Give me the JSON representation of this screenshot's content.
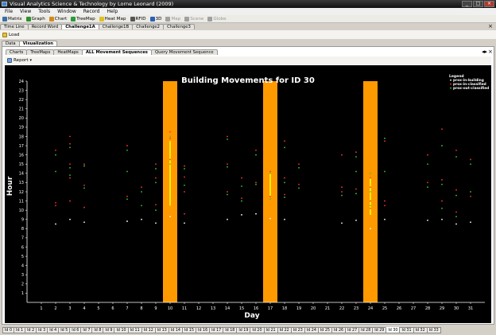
{
  "window": {
    "title": "Visual Analytics Science & Technology by Lorne Leonard (2009)"
  },
  "menu": [
    "File",
    "View",
    "Tools",
    "Window",
    "Record",
    "Help"
  ],
  "toolbar": [
    {
      "label": "Matrix",
      "icon": "matrix-icon",
      "color": "#3a6ea5",
      "enabled": true
    },
    {
      "label": "Graph",
      "icon": "graph-icon",
      "color": "#2f8f2f",
      "enabled": true
    },
    {
      "label": "Chart",
      "icon": "chart-icon",
      "color": "#d08a1a",
      "enabled": true
    },
    {
      "label": "TreeMap",
      "icon": "treemap-icon",
      "color": "#2a9a3a",
      "enabled": true
    },
    {
      "label": "Heat Map",
      "icon": "heatmap-icon",
      "color": "#e0c020",
      "enabled": true
    },
    {
      "label": "RFID",
      "icon": "rfid-icon",
      "color": "#555555",
      "enabled": true
    },
    {
      "label": "3D",
      "icon": "3d-icon",
      "color": "#2b5fb5",
      "enabled": true
    },
    {
      "label": "Map",
      "icon": "map-icon",
      "color": "#a0a0a0",
      "enabled": false
    },
    {
      "label": "Scene",
      "icon": "scene-icon",
      "color": "#a0a0a0",
      "enabled": false
    },
    {
      "label": "Globe",
      "icon": "globe-icon",
      "color": "#a0a0a0",
      "enabled": false
    }
  ],
  "doc_tabs": [
    "Time Line",
    "Record Word",
    "Challenge1A",
    "Challenge1B",
    "Challenge2",
    "Challenge3"
  ],
  "doc_tab_active": 2,
  "load_label": "Load",
  "sub_tabs": [
    "Data",
    "Visualization"
  ],
  "sub_tab_active": 1,
  "viz_tabs": [
    "Charts",
    "TreeMaps",
    "HeatMaps",
    "ALL Movement Sequences",
    "Query Movement Sequence"
  ],
  "viz_tab_active": 3,
  "report_label": "Report",
  "chart_data": {
    "type": "scatter",
    "title": "Building Movements for ID 30",
    "xlabel": "Day",
    "ylabel": "Hour",
    "xlim": [
      0,
      32
    ],
    "ylim": [
      0,
      24
    ],
    "x_ticks": [
      1,
      2,
      3,
      4,
      5,
      6,
      7,
      8,
      9,
      10,
      11,
      12,
      13,
      14,
      15,
      16,
      17,
      18,
      19,
      20,
      21,
      22,
      23,
      24,
      25,
      26,
      27,
      28,
      29,
      30,
      31
    ],
    "y_ticks": [
      1,
      2,
      3,
      4,
      5,
      6,
      7,
      8,
      9,
      10,
      11,
      12,
      13,
      14,
      15,
      16,
      17,
      18,
      19,
      20,
      21,
      22,
      23,
      24
    ],
    "background": "#000000",
    "legend": {
      "title": "Legend",
      "position": "top-right",
      "entries": [
        {
          "name": "prox-in-building",
          "color": "#ffffff"
        },
        {
          "name": "prox-in-classified",
          "color": "#ff3333"
        },
        {
          "name": "prox-out-classified",
          "color": "#33cc33"
        }
      ]
    },
    "highlight_days": [
      10,
      17,
      24
    ],
    "highlight_color": "#ff9900",
    "highlight_segments": [
      {
        "day": 10,
        "y0": 10.5,
        "y1": 17.5
      },
      {
        "day": 17,
        "y0": 11.5,
        "y1": 14
      },
      {
        "day": 24,
        "y0": 9.5,
        "y1": 13.5
      }
    ],
    "series": [
      {
        "name": "prox-in-building",
        "color": "#ffffff",
        "points": [
          [
            2,
            8.5
          ],
          [
            3,
            9
          ],
          [
            4,
            8.7
          ],
          [
            7,
            8.8
          ],
          [
            8,
            9
          ],
          [
            9,
            8.6
          ],
          [
            10,
            9.3
          ],
          [
            11,
            8.6
          ],
          [
            14,
            9
          ],
          [
            15,
            9.5
          ],
          [
            16,
            9.6
          ],
          [
            17,
            9.1
          ],
          [
            18,
            9
          ],
          [
            22,
            8.6
          ],
          [
            23,
            8.9
          ],
          [
            24,
            8
          ],
          [
            25,
            9
          ],
          [
            28,
            8.9
          ],
          [
            29,
            9
          ],
          [
            30,
            8.5
          ],
          [
            31,
            8.7
          ]
        ]
      },
      {
        "name": "prox-in-classified",
        "color": "#ff3333",
        "points": [
          [
            2,
            16.5
          ],
          [
            2,
            10.8
          ],
          [
            2,
            10.5
          ],
          [
            3,
            18
          ],
          [
            3,
            17.2
          ],
          [
            3,
            15
          ],
          [
            3,
            13.5
          ],
          [
            3,
            11
          ],
          [
            4,
            15
          ],
          [
            4,
            12.7
          ],
          [
            4,
            10.3
          ],
          [
            7,
            17
          ],
          [
            7,
            11.5
          ],
          [
            8,
            12.5
          ],
          [
            9,
            15
          ],
          [
            9,
            13.5
          ],
          [
            9,
            10.6
          ],
          [
            10,
            18.5
          ],
          [
            10,
            17.8
          ],
          [
            10,
            15.5
          ],
          [
            11,
            14.8
          ],
          [
            11,
            13.6
          ],
          [
            11,
            12
          ],
          [
            11,
            9.6
          ],
          [
            14,
            18
          ],
          [
            14,
            15
          ],
          [
            14,
            12
          ],
          [
            15,
            13.5
          ],
          [
            15,
            11.3
          ],
          [
            16,
            16.5
          ],
          [
            16,
            13
          ],
          [
            17,
            14.2
          ],
          [
            17,
            11.5
          ],
          [
            18,
            17.5
          ],
          [
            18,
            13.5
          ],
          [
            18,
            11.7
          ],
          [
            19,
            15
          ],
          [
            19,
            12.8
          ],
          [
            22,
            16
          ],
          [
            22,
            12.5
          ],
          [
            22,
            12
          ],
          [
            23,
            16.3
          ],
          [
            23,
            12.3
          ],
          [
            24,
            13.5
          ],
          [
            24,
            12.5
          ],
          [
            24,
            11
          ],
          [
            24,
            10.2
          ],
          [
            25,
            17.5
          ],
          [
            25,
            11
          ],
          [
            25,
            10.5
          ],
          [
            28,
            16
          ],
          [
            28,
            13
          ],
          [
            29,
            18.8
          ],
          [
            29,
            13.3
          ],
          [
            29,
            11
          ],
          [
            30,
            16.5
          ],
          [
            30,
            12.2
          ],
          [
            30,
            9.8
          ],
          [
            31,
            15.5
          ],
          [
            31,
            11.5
          ]
        ]
      },
      {
        "name": "prox-out-classified",
        "color": "#33cc33",
        "points": [
          [
            2,
            16
          ],
          [
            2,
            14.2
          ],
          [
            3,
            16.8
          ],
          [
            3,
            14.6
          ],
          [
            3,
            13.8
          ],
          [
            4,
            14.8
          ],
          [
            4,
            12.4
          ],
          [
            7,
            16.5
          ],
          [
            7,
            14.2
          ],
          [
            7,
            11.2
          ],
          [
            8,
            12
          ],
          [
            8,
            10.5
          ],
          [
            9,
            14.5
          ],
          [
            9,
            13
          ],
          [
            9,
            10
          ],
          [
            10,
            18
          ],
          [
            10,
            15
          ],
          [
            11,
            14.5
          ],
          [
            11,
            12.7
          ],
          [
            14,
            17.7
          ],
          [
            14,
            14.7
          ],
          [
            14,
            11.7
          ],
          [
            15,
            12.6
          ],
          [
            15,
            11
          ],
          [
            16,
            16
          ],
          [
            16,
            12.8
          ],
          [
            17,
            14
          ],
          [
            17,
            11.2
          ],
          [
            18,
            16.8
          ],
          [
            18,
            13
          ],
          [
            18,
            11.4
          ],
          [
            19,
            14.6
          ],
          [
            19,
            12.4
          ],
          [
            22,
            11.6
          ],
          [
            23,
            15.8
          ],
          [
            23,
            14.2
          ],
          [
            23,
            11.8
          ],
          [
            24,
            14
          ],
          [
            24,
            12
          ],
          [
            24,
            10.5
          ],
          [
            25,
            17.8
          ],
          [
            25,
            14.2
          ],
          [
            28,
            15
          ],
          [
            28,
            12.5
          ],
          [
            29,
            17
          ],
          [
            29,
            12.8
          ],
          [
            29,
            10.2
          ],
          [
            30,
            15.8
          ],
          [
            30,
            11.6
          ],
          [
            30,
            9.3
          ],
          [
            31,
            15
          ],
          [
            31,
            12
          ]
        ]
      }
    ]
  },
  "bottom_tabs": [
    "Id 0",
    "Id 1",
    "Id 2",
    "Id 3",
    "Id 4",
    "Id 5",
    "Id 6",
    "Id 7",
    "Id 8",
    "Id 9",
    "Id 10",
    "Id 11",
    "Id 12",
    "Id 13",
    "Id 14",
    "Id 15",
    "Id 16",
    "Id 17",
    "Id 18",
    "Id 19",
    "Id 20",
    "Id 21",
    "Id 22",
    "Id 23",
    "Id 24",
    "Id 25",
    "Id 26",
    "Id 27",
    "Id 28",
    "Id 29",
    "Id 30",
    "Id 31",
    "Id 32",
    "Id 33"
  ],
  "bottom_tab_active": 30
}
